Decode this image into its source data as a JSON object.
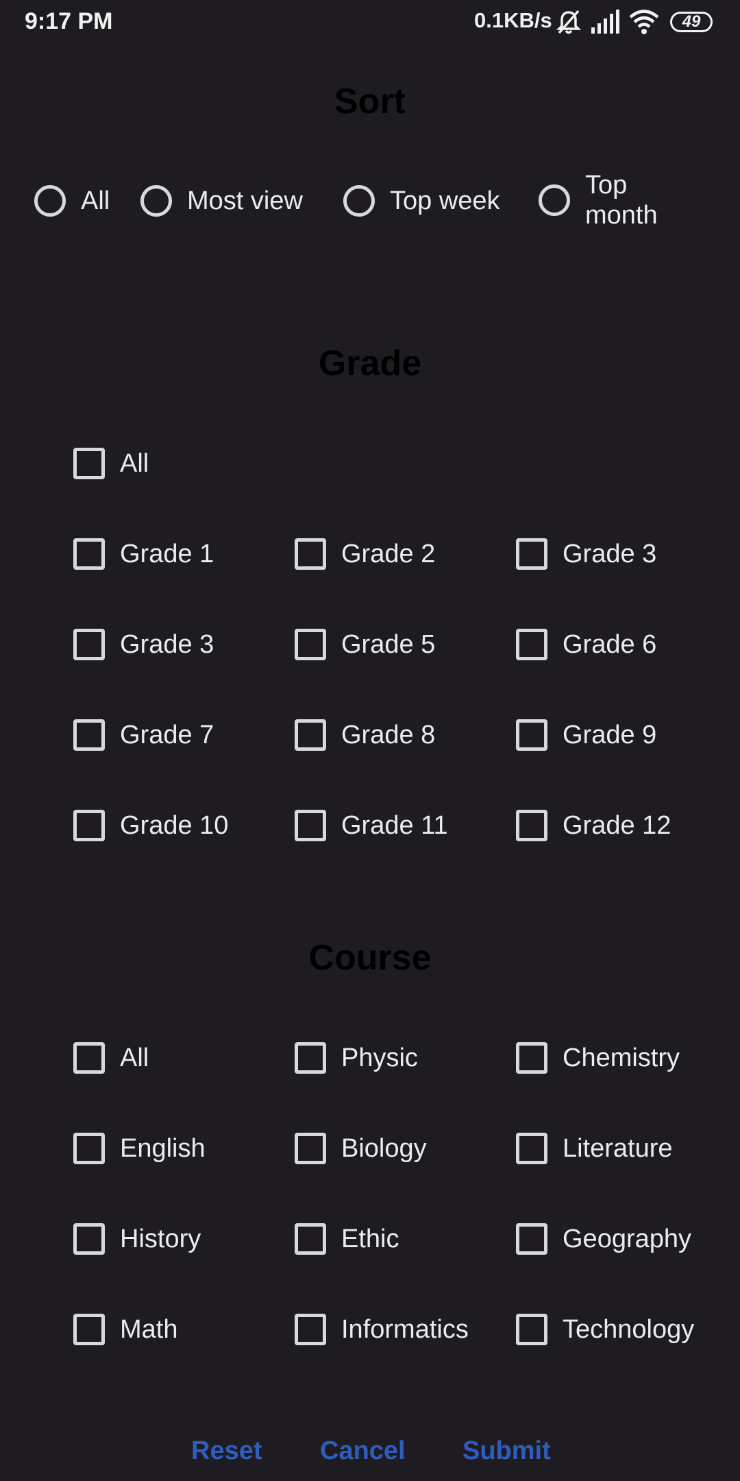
{
  "status_bar": {
    "time": "9:17 PM",
    "net_speed": "0.1KB/s",
    "battery": "49",
    "icons": [
      "mute-icon",
      "signal-icon",
      "wifi-icon",
      "battery-icon"
    ]
  },
  "sort": {
    "title": "Sort",
    "options": [
      {
        "label": "All",
        "selected": false
      },
      {
        "label": "Most view",
        "selected": false
      },
      {
        "label": "Top week",
        "selected": false
      },
      {
        "label": "Top month",
        "selected": false
      }
    ]
  },
  "grade": {
    "title": "Grade",
    "items": [
      "All",
      "Grade 1",
      "Grade 2",
      "Grade 3",
      "Grade 3",
      "Grade 5",
      "Grade 6",
      "Grade 7",
      "Grade 8",
      "Grade 9",
      "Grade 10",
      "Grade 11",
      "Grade 12"
    ]
  },
  "course": {
    "title": "Course",
    "items": [
      "All",
      "Physic",
      "Chemistry",
      "English",
      "Biology",
      "Literature",
      "History",
      "Ethic",
      "Geography",
      "Math",
      "Informatics",
      "Technology"
    ]
  },
  "actions": {
    "reset": "Reset",
    "cancel": "Cancel",
    "submit": "Submit"
  },
  "colors": {
    "background": "#1e1c21",
    "accent": "#2d5dbf",
    "title": "#000000"
  }
}
